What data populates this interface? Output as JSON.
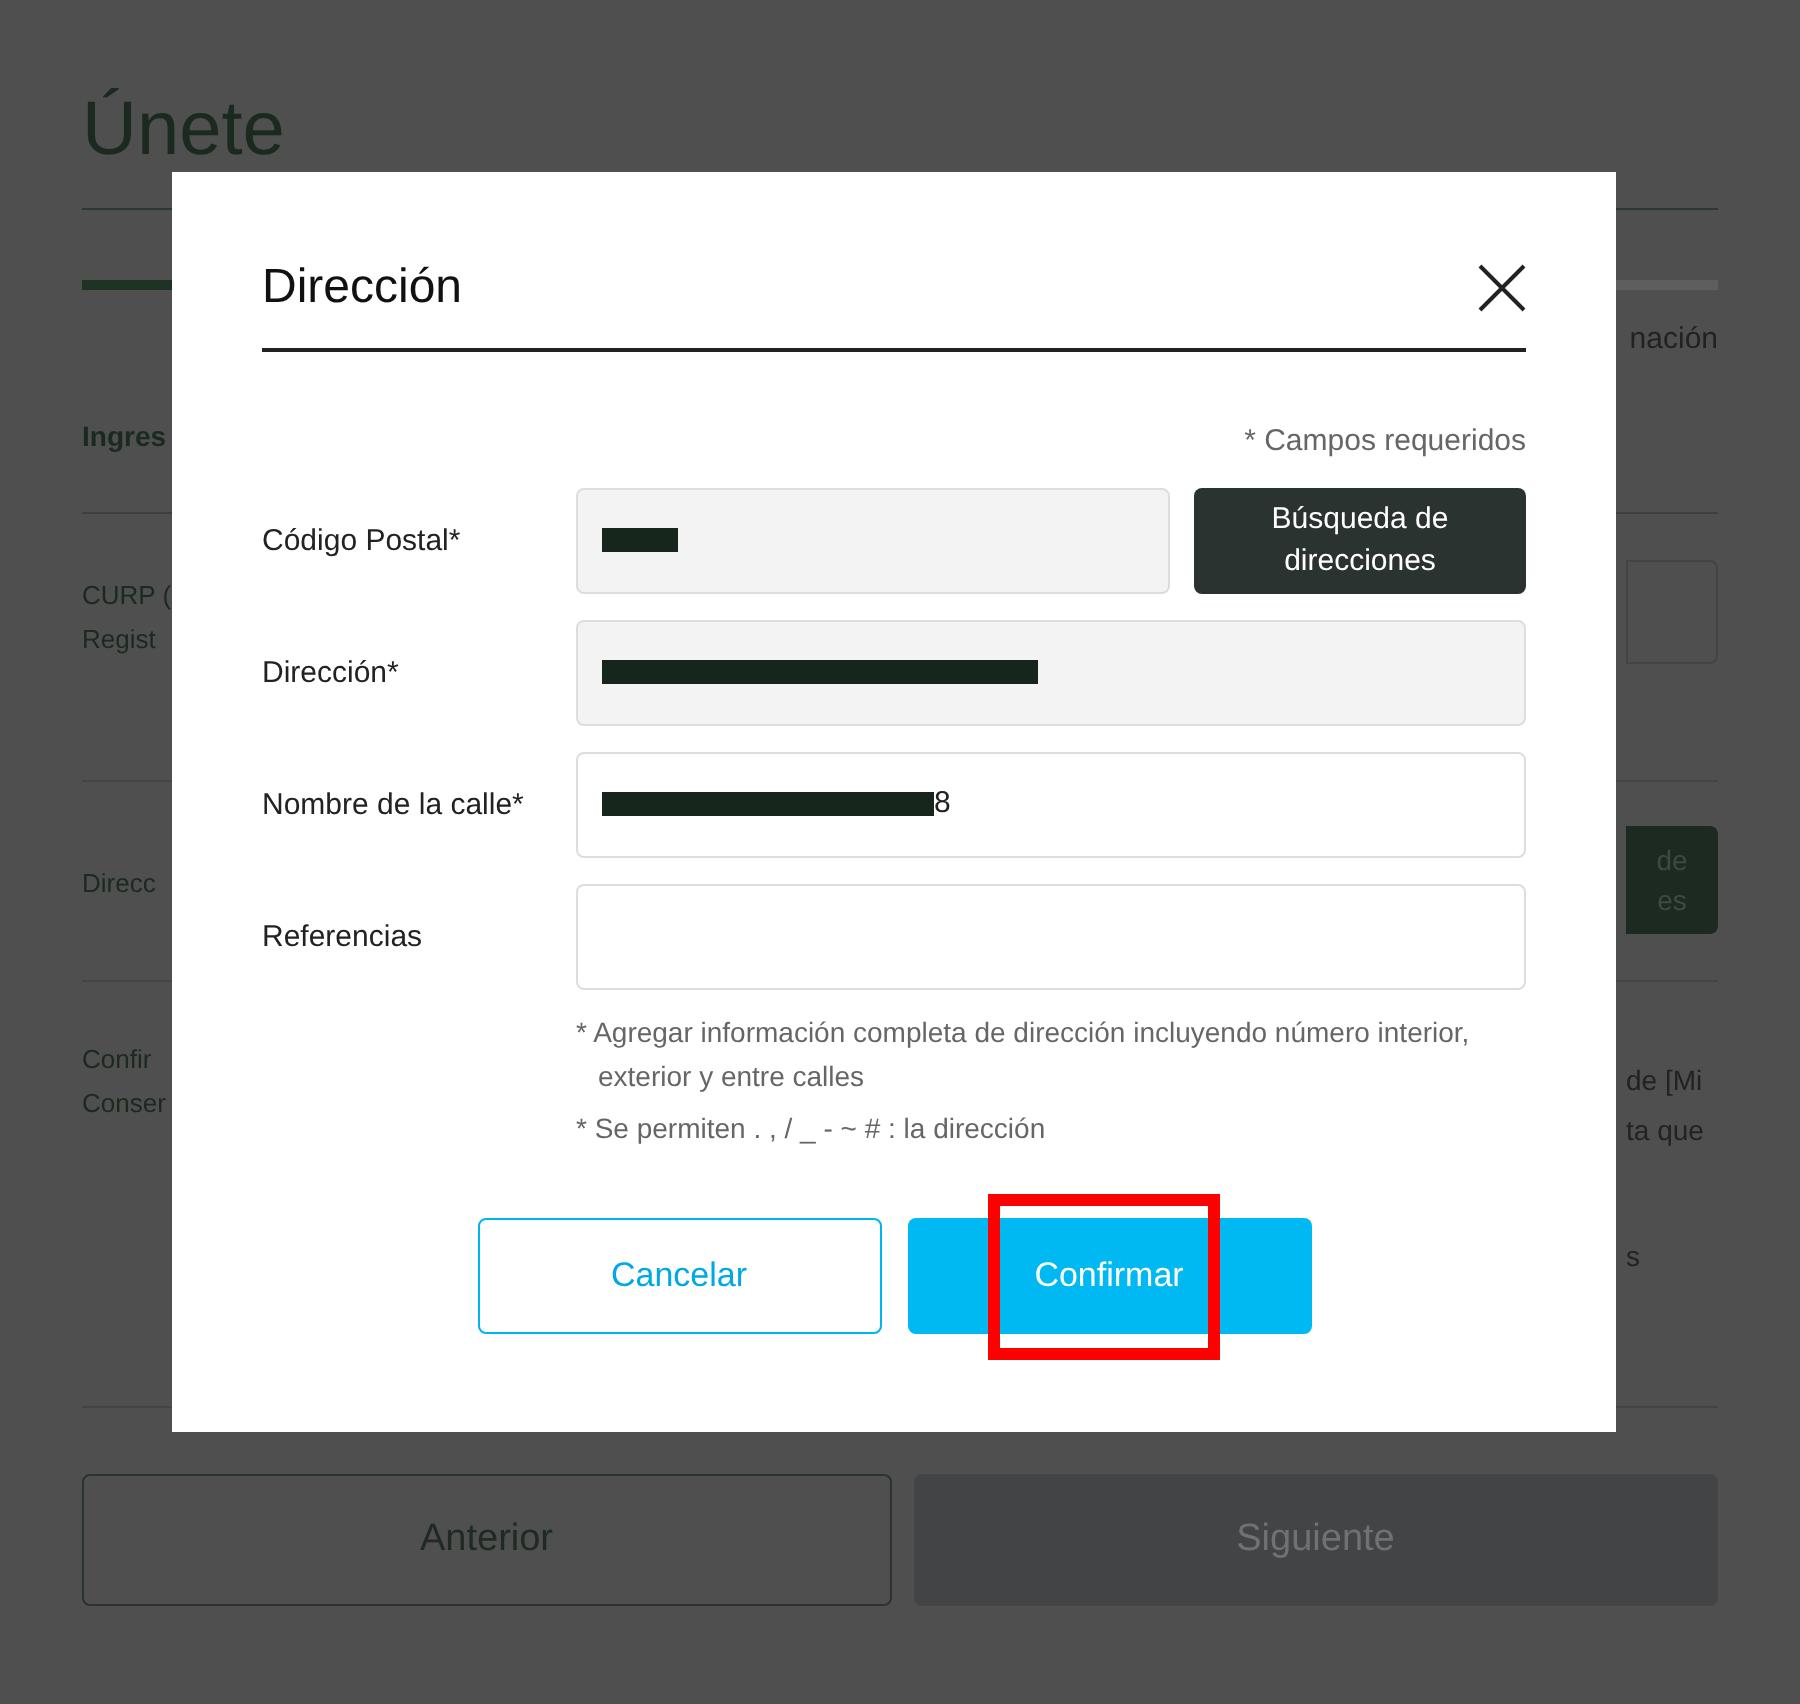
{
  "page": {
    "title": "Únete",
    "progress": {
      "level": 0.5
    },
    "step_label": "nación",
    "section_heading": "Ingres",
    "rows": [
      {
        "kind": "input",
        "left": [
          "CURP (",
          "Regist"
        ],
        "right": []
      },
      {
        "kind": "button",
        "left": [
          "Direcc"
        ],
        "right": [
          "de",
          "es"
        ]
      },
      {
        "kind": "text",
        "left": [
          "Confir",
          "Conser"
        ],
        "right": [
          "de [Mi",
          "ta que",
          "s"
        ]
      }
    ],
    "buttons": [
      {
        "label": "Anterior",
        "disabled": false
      },
      {
        "label": "Siguiente",
        "disabled": true
      }
    ]
  },
  "dialog": {
    "title": "Dirección",
    "required_note": "* Campos requeridos",
    "fields": [
      {
        "label": "Código Postal*",
        "readonly": true,
        "redacted": true,
        "button": "Búsqueda de direcciones"
      },
      {
        "label": "Dirección*",
        "readonly": true,
        "redacted": true
      },
      {
        "label": "Nombre de la calle*",
        "readonly": false,
        "redacted": true,
        "value": "8"
      },
      {
        "label": "Referencias",
        "readonly": false,
        "redacted": false
      }
    ],
    "notes": [
      "* Agregar información completa de dirección incluyendo número interior, exterior y entre calles",
      "* Se permiten . , / _ - ~ # : la dirección"
    ],
    "buttons": [
      {
        "label": "Cancelar",
        "kind": "outline",
        "highlighted": false
      },
      {
        "label": "Confirmar",
        "kind": "primary",
        "highlighted": true
      }
    ]
  }
}
